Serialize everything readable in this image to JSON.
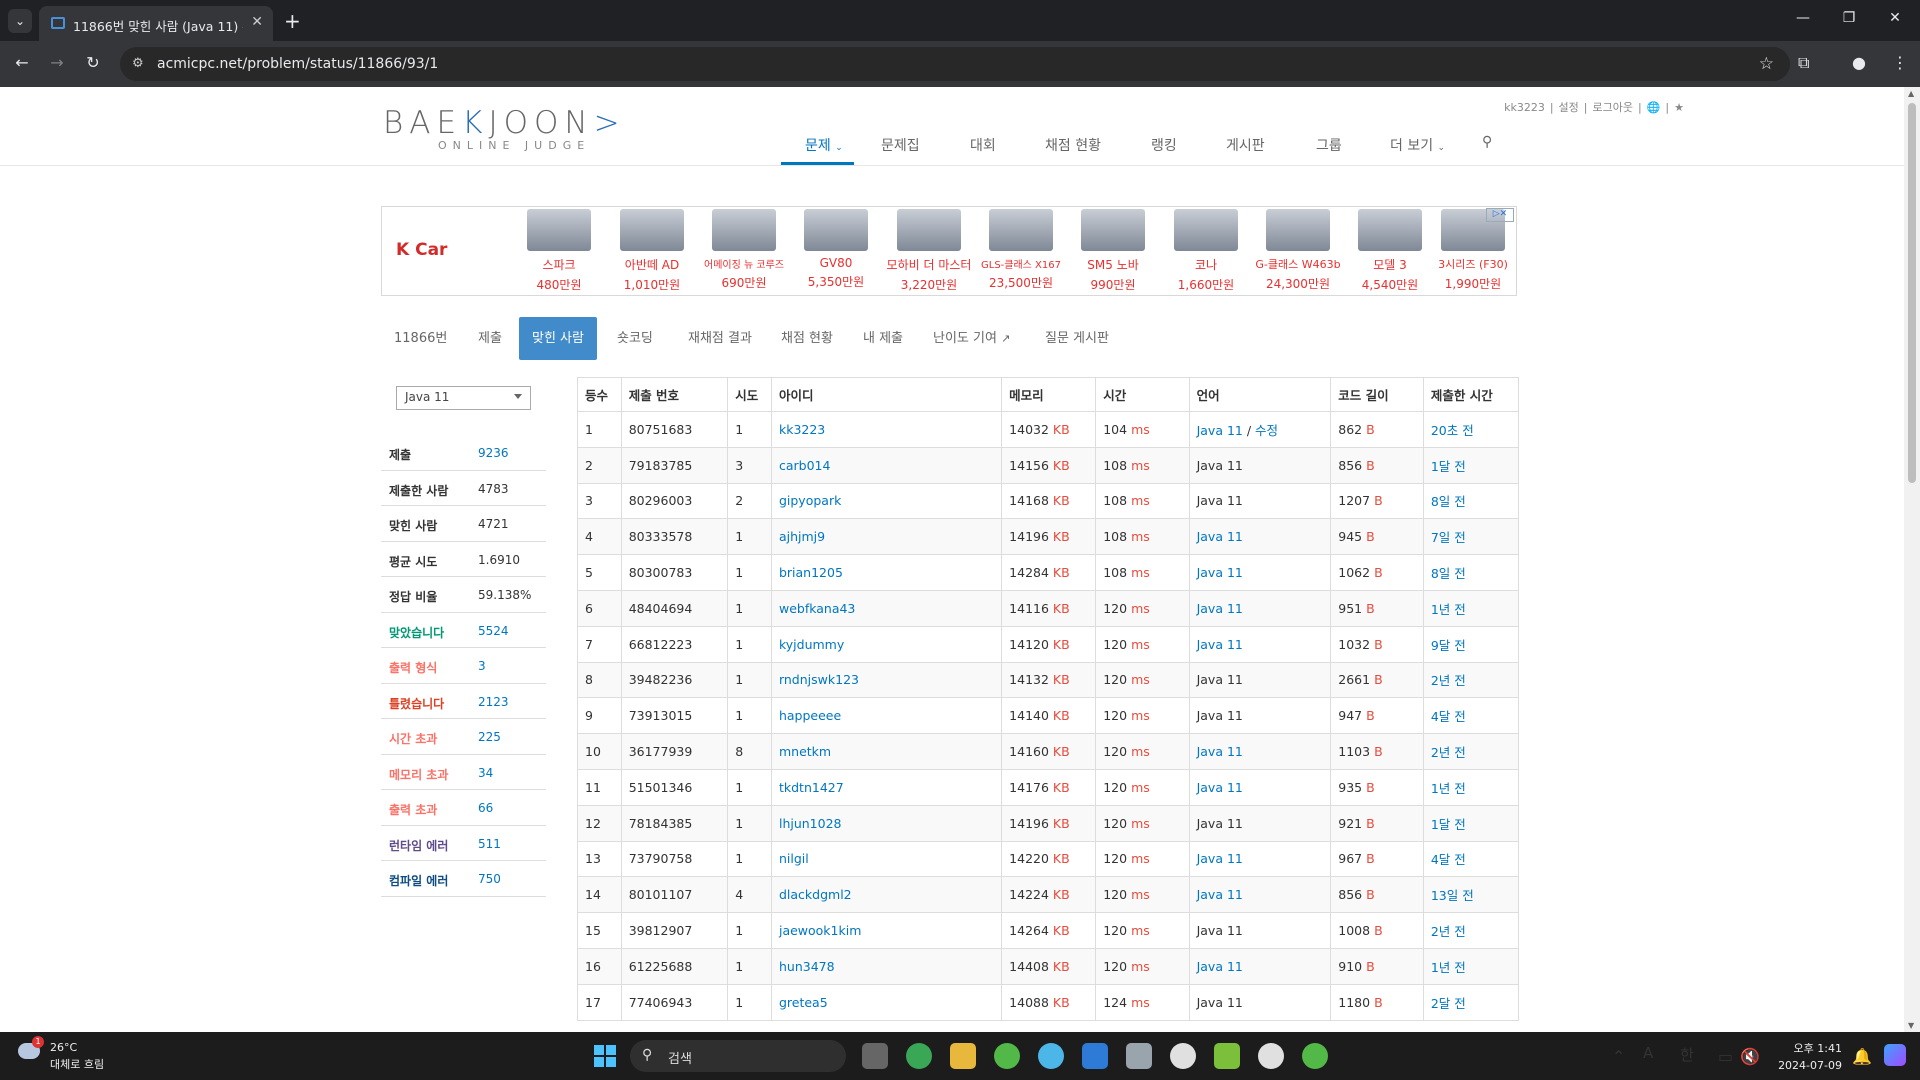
{
  "browser": {
    "tab_title": "11866번 맞힌 사람 (Java 11) -",
    "url": "acmicpc.net/problem/status/11866/93/1"
  },
  "site": {
    "logo_main_1": "BAE",
    "logo_main_2": "K",
    "logo_main_3": "JOON",
    "logo_sub": "ONLINE JUDGE",
    "top_links": [
      "kk3223",
      "설정",
      "로그아웃"
    ],
    "nav": [
      "문제",
      "문제집",
      "대회",
      "채점 현황",
      "랭킹",
      "게시판",
      "그룹",
      "더 보기"
    ]
  },
  "ad": {
    "brand": "K Car",
    "cars": [
      {
        "name": "스파크",
        "price": "480만원"
      },
      {
        "name": "아반떼 AD",
        "price": "1,010만원"
      },
      {
        "name": "어메이징 뉴 코루즈",
        "price": "690만원"
      },
      {
        "name": "GV80",
        "price": "5,350만원"
      },
      {
        "name": "모하비 더 마스터",
        "price": "3,220만원"
      },
      {
        "name": "GLS-클래스 X167",
        "price": "23,500만원"
      },
      {
        "name": "SM5 노바",
        "price": "990만원"
      },
      {
        "name": "코나",
        "price": "1,660만원"
      },
      {
        "name": "G-클래스 W463b",
        "price": "24,300만원"
      },
      {
        "name": "모델 3",
        "price": "4,540만원"
      },
      {
        "name": "3시리즈 (F30)",
        "price": "1,990만원"
      }
    ]
  },
  "subtabs": [
    "11866번",
    "제출",
    "맞힌 사람",
    "숏코딩",
    "재채점 결과",
    "채점 현황",
    "내 제출",
    "난이도 기여",
    "질문 게시판"
  ],
  "language_filter": "Java 11",
  "stats": [
    {
      "label": "제출",
      "value": "9236",
      "label_color": "#333333",
      "value_color": "#0076C0"
    },
    {
      "label": "제출한 사람",
      "value": "4783",
      "label_color": "#333333",
      "value_color": "#333333"
    },
    {
      "label": "맞힌 사람",
      "value": "4721",
      "label_color": "#333333",
      "value_color": "#333333"
    },
    {
      "label": "평균 시도",
      "value": "1.6910",
      "label_color": "#333333",
      "value_color": "#333333"
    },
    {
      "label": "정답 비율",
      "value": "59.138%",
      "label_color": "#333333",
      "value_color": "#333333"
    },
    {
      "label": "맞았습니다",
      "value": "5524",
      "label_color": "#009874",
      "value_color": "#0076C0"
    },
    {
      "label": "출력 형식",
      "value": "3",
      "label_color": "#fa7268",
      "value_color": "#0076C0"
    },
    {
      "label": "틀렸습니다",
      "value": "2123",
      "label_color": "#dd4124",
      "value_color": "#0076C0"
    },
    {
      "label": "시간 초과",
      "value": "225",
      "label_color": "#fa7268",
      "value_color": "#0076C0"
    },
    {
      "label": "메모리 초과",
      "value": "34",
      "label_color": "#fa7268",
      "value_color": "#0076C0"
    },
    {
      "label": "출력 초과",
      "value": "66",
      "label_color": "#fa7268",
      "value_color": "#0076C0"
    },
    {
      "label": "런타임 에러",
      "value": "511",
      "label_color": "#5f4b8b",
      "value_color": "#0076C0"
    },
    {
      "label": "컴파일 에러",
      "value": "750",
      "label_color": "#0f4c81",
      "value_color": "#0076C0"
    }
  ],
  "table": {
    "headers": [
      "등수",
      "제출 번호",
      "시도",
      "아이디",
      "메모리",
      "시간",
      "언어",
      "코드 길이",
      "제출한 시간"
    ],
    "units": {
      "memory": "KB",
      "time": "ms",
      "code": "B"
    },
    "edit_label": "수정",
    "rows": [
      {
        "rank": "1",
        "id": "80751683",
        "tries": "1",
        "user": "kk3223",
        "mem": "14032",
        "time": "104",
        "lang": "Java 11",
        "lang_link": true,
        "edit": true,
        "code": "862",
        "ago": "20초 전"
      },
      {
        "rank": "2",
        "id": "79183785",
        "tries": "3",
        "user": "carb014",
        "mem": "14156",
        "time": "108",
        "lang": "Java 11",
        "lang_link": false,
        "edit": false,
        "code": "856",
        "ago": "1달 전"
      },
      {
        "rank": "3",
        "id": "80296003",
        "tries": "2",
        "user": "gipyopark",
        "mem": "14168",
        "time": "108",
        "lang": "Java 11",
        "lang_link": false,
        "edit": false,
        "code": "1207",
        "ago": "8일 전"
      },
      {
        "rank": "4",
        "id": "80333578",
        "tries": "1",
        "user": "ajhjmj9",
        "mem": "14196",
        "time": "108",
        "lang": "Java 11",
        "lang_link": true,
        "edit": false,
        "code": "945",
        "ago": "7일 전"
      },
      {
        "rank": "5",
        "id": "80300783",
        "tries": "1",
        "user": "brian1205",
        "mem": "14284",
        "time": "108",
        "lang": "Java 11",
        "lang_link": true,
        "edit": false,
        "code": "1062",
        "ago": "8일 전"
      },
      {
        "rank": "6",
        "id": "48404694",
        "tries": "1",
        "user": "webfkana43",
        "mem": "14116",
        "time": "120",
        "lang": "Java 11",
        "lang_link": true,
        "edit": false,
        "code": "951",
        "ago": "1년 전"
      },
      {
        "rank": "7",
        "id": "66812223",
        "tries": "1",
        "user": "kyjdummy",
        "mem": "14120",
        "time": "120",
        "lang": "Java 11",
        "lang_link": true,
        "edit": false,
        "code": "1032",
        "ago": "9달 전"
      },
      {
        "rank": "8",
        "id": "39482236",
        "tries": "1",
        "user": "rndnjswk123",
        "mem": "14132",
        "time": "120",
        "lang": "Java 11",
        "lang_link": false,
        "edit": false,
        "code": "2661",
        "ago": "2년 전"
      },
      {
        "rank": "9",
        "id": "73913015",
        "tries": "1",
        "user": "happeeee",
        "mem": "14140",
        "time": "120",
        "lang": "Java 11",
        "lang_link": false,
        "edit": false,
        "code": "947",
        "ago": "4달 전"
      },
      {
        "rank": "10",
        "id": "36177939",
        "tries": "8",
        "user": "mnetkm",
        "mem": "14160",
        "time": "120",
        "lang": "Java 11",
        "lang_link": true,
        "edit": false,
        "code": "1103",
        "ago": "2년 전"
      },
      {
        "rank": "11",
        "id": "51501346",
        "tries": "1",
        "user": "tkdtn1427",
        "mem": "14176",
        "time": "120",
        "lang": "Java 11",
        "lang_link": true,
        "edit": false,
        "code": "935",
        "ago": "1년 전"
      },
      {
        "rank": "12",
        "id": "78184385",
        "tries": "1",
        "user": "lhjun1028",
        "mem": "14196",
        "time": "120",
        "lang": "Java 11",
        "lang_link": false,
        "edit": false,
        "code": "921",
        "ago": "1달 전"
      },
      {
        "rank": "13",
        "id": "73790758",
        "tries": "1",
        "user": "nilgil",
        "mem": "14220",
        "time": "120",
        "lang": "Java 11",
        "lang_link": true,
        "edit": false,
        "code": "967",
        "ago": "4달 전"
      },
      {
        "rank": "14",
        "id": "80101107",
        "tries": "4",
        "user": "dlackdgml2",
        "mem": "14224",
        "time": "120",
        "lang": "Java 11",
        "lang_link": true,
        "edit": false,
        "code": "856",
        "ago": "13일 전"
      },
      {
        "rank": "15",
        "id": "39812907",
        "tries": "1",
        "user": "jaewook1kim",
        "mem": "14264",
        "time": "120",
        "lang": "Java 11",
        "lang_link": false,
        "edit": false,
        "code": "1008",
        "ago": "2년 전"
      },
      {
        "rank": "16",
        "id": "61225688",
        "tries": "1",
        "user": "hun3478",
        "mem": "14408",
        "time": "120",
        "lang": "Java 11",
        "lang_link": true,
        "edit": false,
        "code": "910",
        "ago": "1년 전"
      },
      {
        "rank": "17",
        "id": "77406943",
        "tries": "1",
        "user": "gretea5",
        "mem": "14088",
        "time": "124",
        "lang": "Java 11",
        "lang_link": false,
        "edit": false,
        "code": "1180",
        "ago": "2달 전"
      }
    ]
  },
  "taskbar": {
    "weather_temp": "26°C",
    "weather_desc": "대체로 흐림",
    "weather_badge": "1",
    "search_placeholder": "검색",
    "ime_mode": "A",
    "ime_lang": "한",
    "time": "오후 1:41",
    "date": "2024-07-09"
  }
}
